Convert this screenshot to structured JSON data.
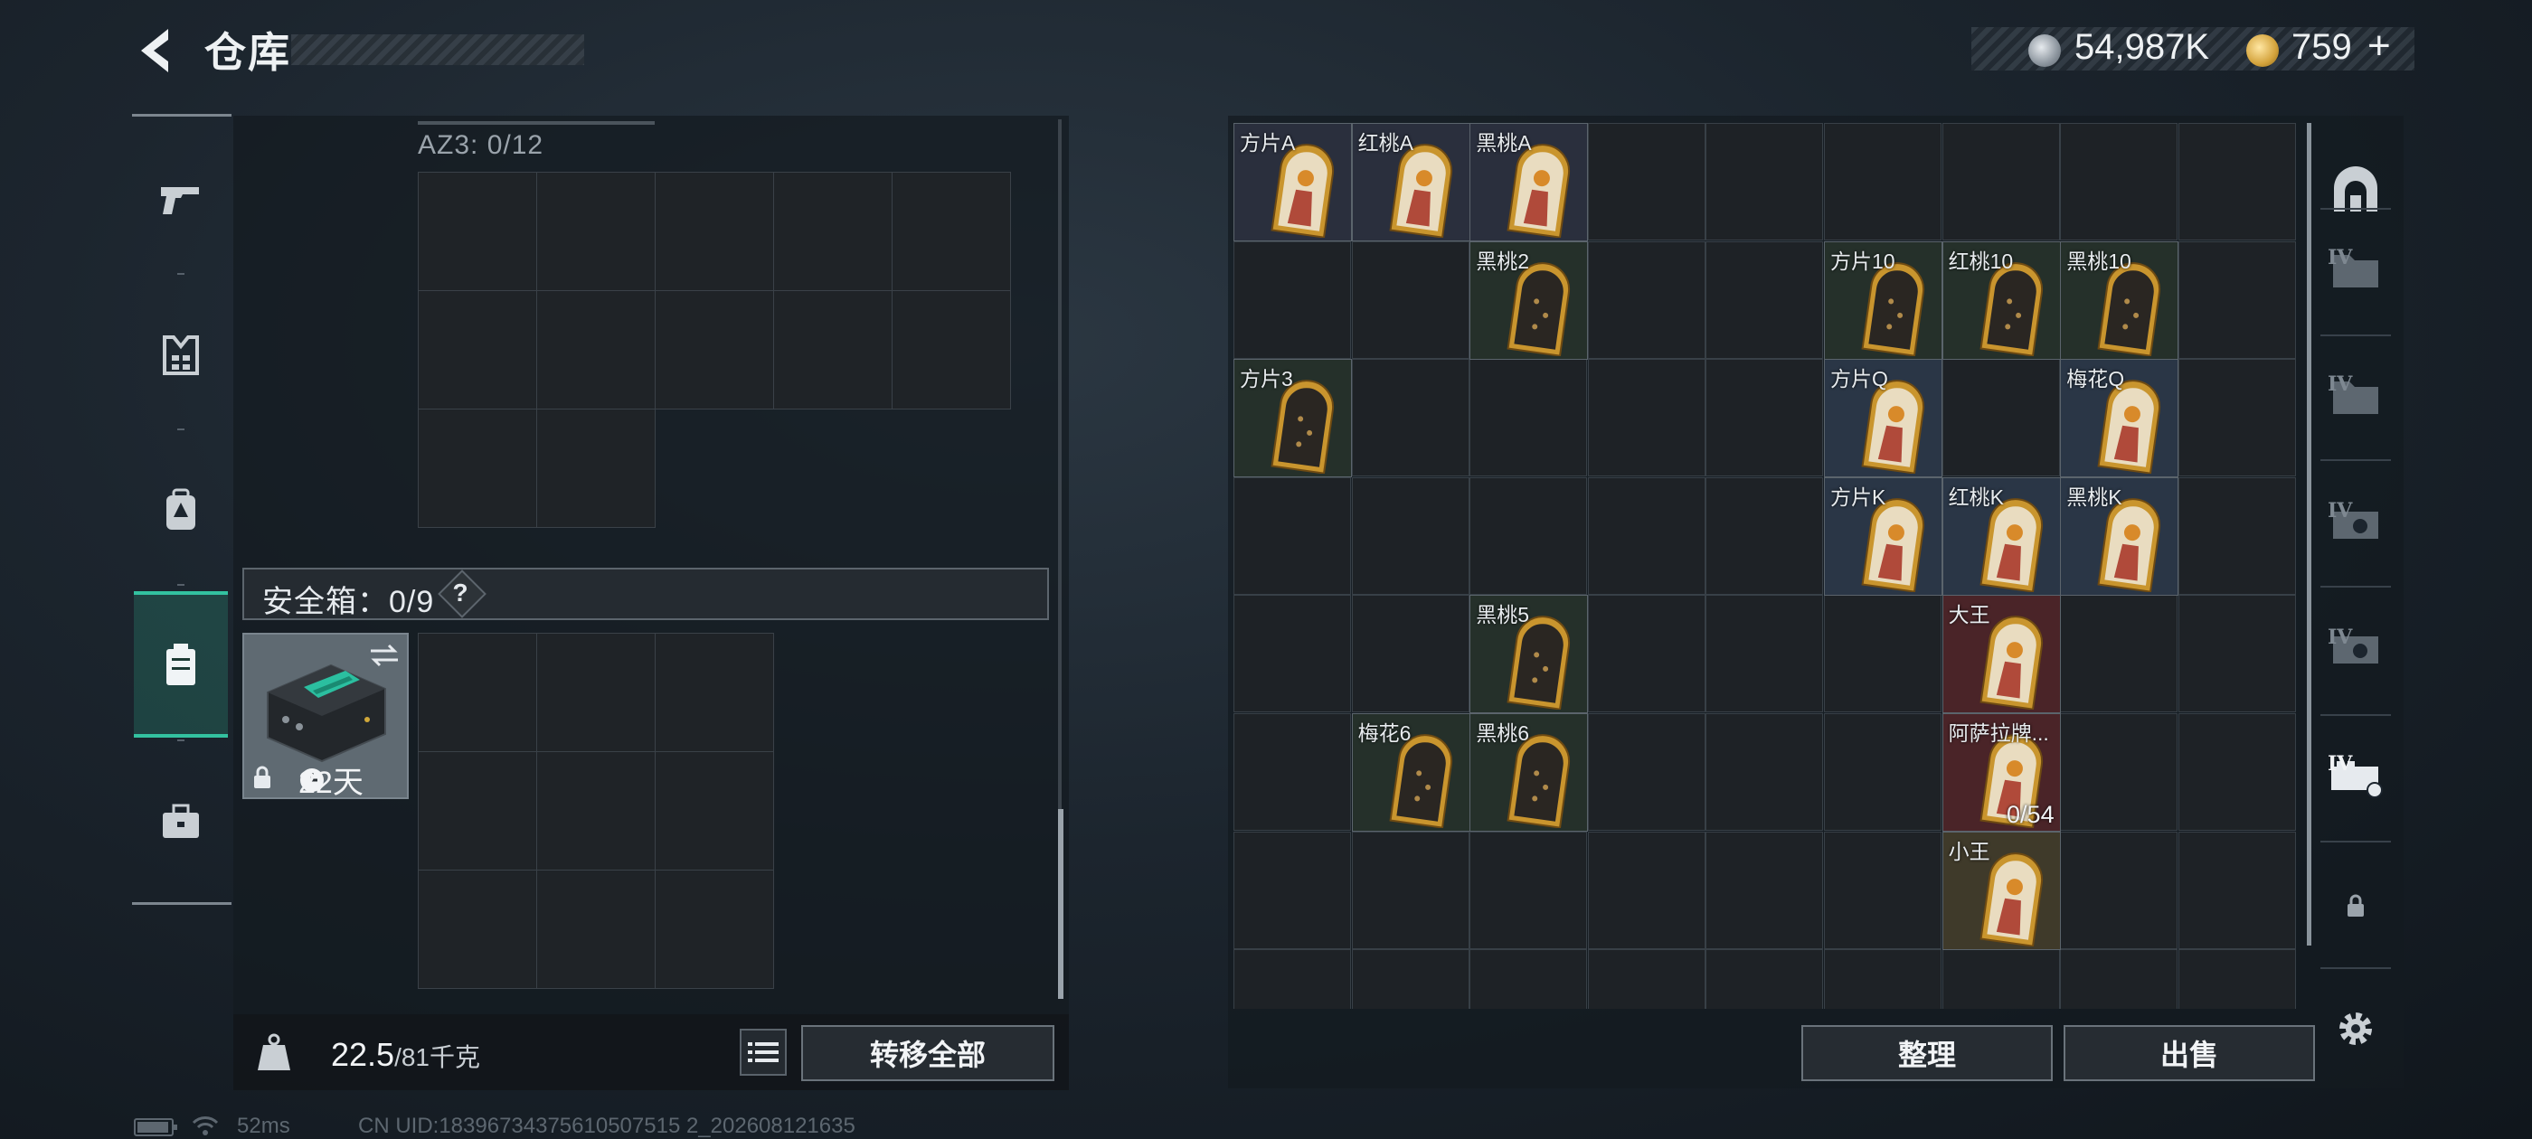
{
  "header": {
    "title": "仓库",
    "currency_silver": "54,987K",
    "currency_gold": "759",
    "currency_plus": "+"
  },
  "left_rail": [
    "pistol-icon",
    "armor-vest-icon",
    "backpack-icon",
    "safebox-icon",
    "briefcase-icon"
  ],
  "left_panel": {
    "container_label": "AZ3: 0/12",
    "safe_box_label": "安全箱：0/9",
    "safe_box_help": "?",
    "safe_box_days": "22天",
    "weight_current": "22.5",
    "weight_max": "/81千克",
    "transfer_all": "转移全部"
  },
  "stash": {
    "cards": [
      {
        "name": "方片A",
        "style": "face"
      },
      {
        "name": "红桃A",
        "style": "face"
      },
      {
        "name": "黑桃A",
        "style": "face"
      },
      {
        "name": "黑桃2",
        "style": "green"
      },
      {
        "name": "方片10",
        "style": "green"
      },
      {
        "name": "红桃10",
        "style": "green"
      },
      {
        "name": "黑桃10",
        "style": "green"
      },
      {
        "name": "方片3",
        "style": "green"
      },
      {
        "name": "方片Q",
        "style": "blue"
      },
      {
        "name": "梅花Q",
        "style": "blue"
      },
      {
        "name": "方片K",
        "style": "blue"
      },
      {
        "name": "红桃K",
        "style": "blue"
      },
      {
        "name": "黑桃K",
        "style": "blue"
      },
      {
        "name": "黑桃5",
        "style": "green"
      },
      {
        "name": "大王",
        "style": "red"
      },
      {
        "name": "梅花6",
        "style": "green"
      },
      {
        "name": "黑桃6",
        "style": "green"
      },
      {
        "name": "阿萨拉牌...",
        "style": "red",
        "count": "0/54"
      },
      {
        "name": "小王",
        "style": "gold"
      }
    ],
    "sort": "整理",
    "sell": "出售"
  },
  "right_rail": {
    "tier_label": "IV"
  },
  "status_bar": {
    "ping": "52ms",
    "uid": "CN UID:18396734375610507515 2_202608121635"
  },
  "colors": {
    "accent_teal": "#33c2a0",
    "card_gold": "#d8a53a"
  }
}
